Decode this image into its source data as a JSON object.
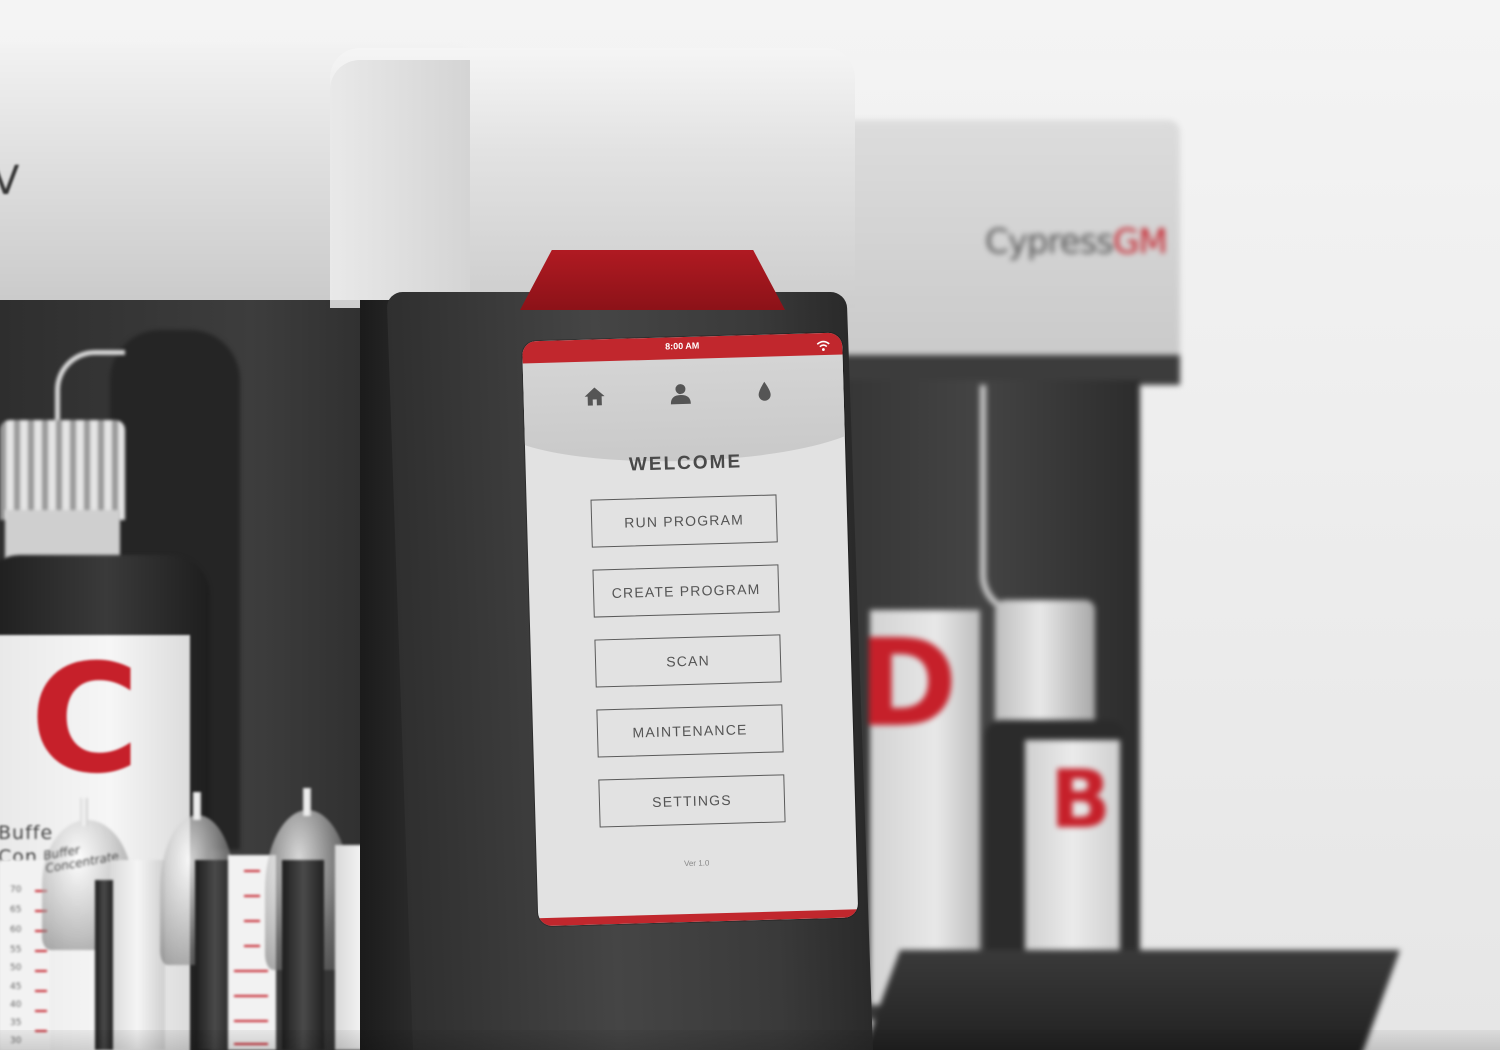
{
  "background_product": {
    "logo_text": "Cypress",
    "logo_accent": "GM"
  },
  "left_product": {
    "brand_fragment": "V",
    "bottle_letter": "C",
    "bottle_text_line1": "Buffe",
    "bottle_text_line2": "Con",
    "syringe_label": "Buffer Concentrate",
    "syringe_scale_labels": [
      "70",
      "65",
      "60",
      "55",
      "50",
      "45",
      "40",
      "35",
      "30"
    ]
  },
  "background_bottles": {
    "letter_d": "D",
    "letter_b": "B"
  },
  "screen": {
    "status_bar": {
      "time": "8:00 AM",
      "wifi_icon": "wifi-icon"
    },
    "nav": {
      "home_icon": "home-icon",
      "user_icon": "user-icon",
      "drop_icon": "drop-icon"
    },
    "title": "WELCOME",
    "menu": [
      {
        "label": "RUN PROGRAM"
      },
      {
        "label": "CREATE PROGRAM"
      },
      {
        "label": "SCAN"
      },
      {
        "label": "MAINTENANCE"
      },
      {
        "label": "SETTINGS"
      }
    ],
    "version": "Ver 1.0"
  },
  "colors": {
    "accent_red": "#c1272d",
    "button_border": "#5a5a5a",
    "screen_bg": "#e2e2e2",
    "body_dark": "#3a3a3a"
  }
}
